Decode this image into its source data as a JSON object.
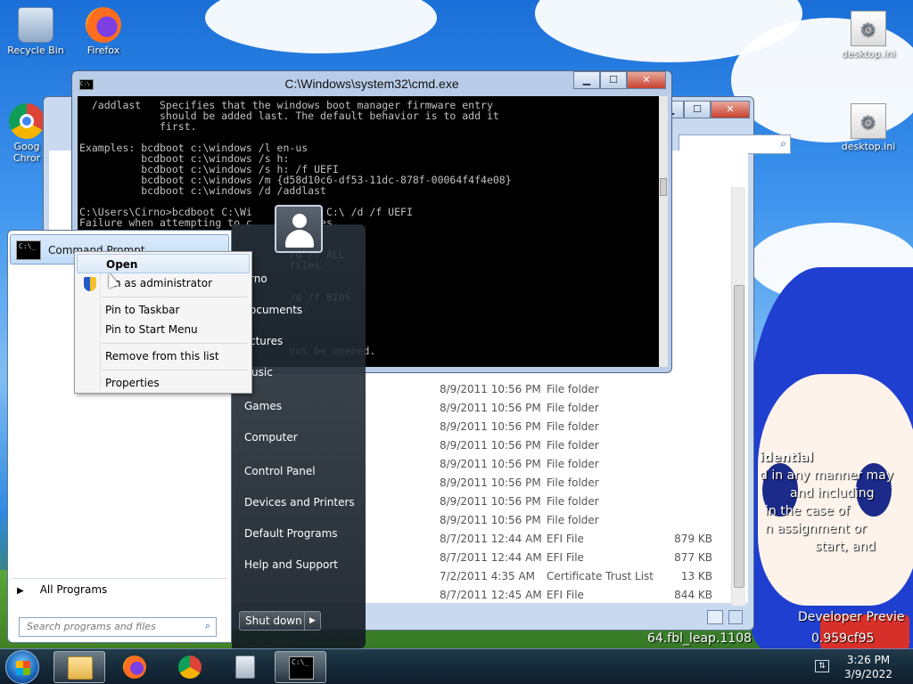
{
  "desktop": {
    "icons": [
      {
        "label": "Recycle Bin"
      },
      {
        "label": "Firefox"
      },
      {
        "label": "Goog Chror"
      },
      {
        "label": "desktop.ini"
      },
      {
        "label": "desktop.ini"
      }
    ],
    "watermark": {
      "line1": "idential",
      "line2": "d in any manner may",
      "line3": "and including",
      "line4": "in the case of",
      "line5": "n assignment or",
      "line6": "start, and",
      "line7": "Developer Previe",
      "line8": "64.fbl_leap.1108",
      "line9": "0.959cf95"
    }
  },
  "cmd_window": {
    "title": "C:\\Windows\\system32\\cmd.exe",
    "icon_text": "C:\\",
    "buttons": {
      "minimize": "▁",
      "maximize": "☐",
      "close": "✕"
    },
    "console_text": "  /addlast   Specifies that the windows boot manager firmware entry\n             should be added last. The default behavior is to add it\n             first.\n\nExamples: bcdboot c:\\windows /l en-us\n          bcdboot c:\\windows /s h:\n          bcdboot c:\\windows /s h: /f UEFI\n          bcdboot c:\\windows /m {d58d10c6-df53-11dc-878f-00064f4f4e08}\n          bcdboot c:\\windows /d /addlast\n\nC:\\Users\\Cirno>bcdboot C:\\Wi      ws /s C:\\ /d /f UEFI\nFailure when attempting to c      t files.\n\n\n                                  /d /f ALL\n                                  files.\n\n\n                                  /d /f BIOS\n                                  es.\n\n\n\n                                  not be opened."
  },
  "explorer": {
    "buttons": {
      "minimize": "▁",
      "maximize": "☐",
      "close": "✕"
    },
    "files": [
      {
        "date": "8/9/2011 10:56 PM",
        "type": "File folder",
        "size": ""
      },
      {
        "date": "8/9/2011 10:56 PM",
        "type": "File folder",
        "size": ""
      },
      {
        "date": "8/9/2011 10:56 PM",
        "type": "File folder",
        "size": ""
      },
      {
        "date": "8/9/2011 10:56 PM",
        "type": "File folder",
        "size": ""
      },
      {
        "date": "8/9/2011 10:56 PM",
        "type": "File folder",
        "size": ""
      },
      {
        "date": "8/9/2011 10:56 PM",
        "type": "File folder",
        "size": ""
      },
      {
        "date": "8/9/2011 10:56 PM",
        "type": "File folder",
        "size": ""
      },
      {
        "date": "8/9/2011 10:56 PM",
        "type": "File folder",
        "size": ""
      },
      {
        "date": "8/7/2011 12:44 AM",
        "type": "EFI File",
        "size": "879 KB"
      },
      {
        "date": "8/7/2011 12:44 AM",
        "type": "EFI File",
        "size": "877 KB"
      },
      {
        "date": "7/2/2011 4:35 AM",
        "type": "Certificate Trust List",
        "size": "13 KB"
      },
      {
        "date": "8/7/2011 12:45 AM",
        "type": "EFI File",
        "size": "844 KB"
      }
    ]
  },
  "start_menu": {
    "pinned_item": "Command Prompt",
    "pinned_icon_text": "C:\\_",
    "all_programs": "All Programs",
    "search_placeholder": "Search programs and files",
    "right_links": [
      "rno",
      "ocuments",
      "ctures",
      "usic",
      "Games",
      "Computer",
      "Control Panel",
      "Devices and Printers",
      "Default Programs",
      "Help and Support"
    ],
    "shutdown": "Shut down"
  },
  "context_menu": {
    "items": [
      {
        "label": "Open",
        "bold": true,
        "highlighted": true
      },
      {
        "label": "n as administrator",
        "shield": true
      },
      {
        "label": "Pin to Taskbar"
      },
      {
        "label": "Pin to Start Menu"
      },
      {
        "label": "Remove from this list"
      },
      {
        "label": "Properties"
      }
    ]
  },
  "taskbar": {
    "cmd_icon_text": "C:\\_",
    "clock_time": "3:26 PM",
    "clock_date": "3/9/2022"
  }
}
